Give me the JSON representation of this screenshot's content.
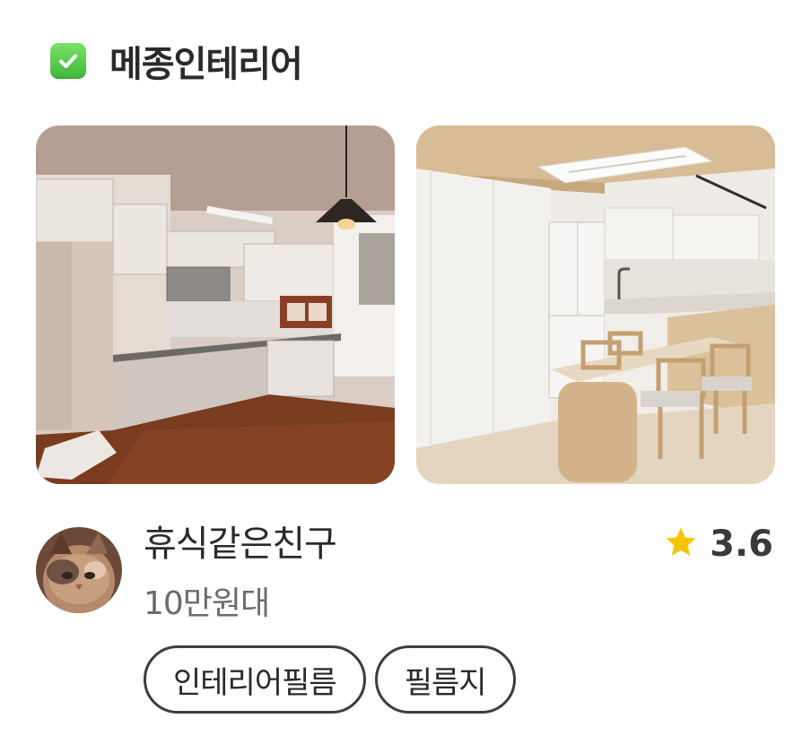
{
  "header": {
    "icon": "check-mark-icon",
    "company_name": "메종인테리어"
  },
  "photos": [
    {
      "label": "before-kitchen-photo"
    },
    {
      "label": "after-kitchen-photo"
    }
  ],
  "review": {
    "avatar": "cat-avatar",
    "reviewer_name": "휴식같은친구",
    "price_range": "10만원대",
    "rating": "3.6",
    "rating_icon": "star-icon",
    "star_color": "#f5c400"
  },
  "tags": [
    "인테리어필름",
    "필름지"
  ],
  "colors": {
    "check_green": "#4cc444",
    "text_dark": "#2a2a2a",
    "text_muted": "#6b6b6b"
  }
}
